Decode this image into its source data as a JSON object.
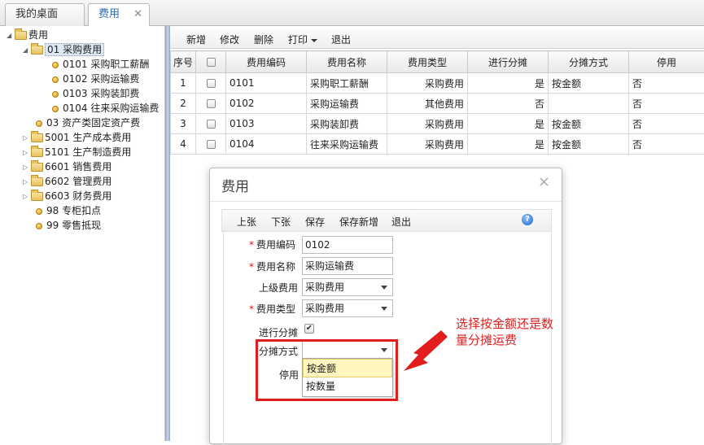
{
  "tabs": {
    "home": "我的桌面",
    "active": "费用",
    "close_glyph": "✕"
  },
  "tree": {
    "root": "费用",
    "nodes": [
      {
        "label": "01 采购费用",
        "level": 1,
        "kind": "folder-open"
      },
      {
        "label": "0101 采购职工薪酬",
        "level": 2,
        "kind": "leaf"
      },
      {
        "label": "0102 采购运输费",
        "level": 2,
        "kind": "leaf"
      },
      {
        "label": "0103 采购装卸费",
        "level": 2,
        "kind": "leaf"
      },
      {
        "label": "0104 往来采购运输费",
        "level": 2,
        "kind": "leaf"
      },
      {
        "label": "03 资产类固定资产费",
        "level": 1,
        "kind": "leaf"
      },
      {
        "label": "5001 生产成本费用",
        "level": 1,
        "kind": "folder"
      },
      {
        "label": "5101 生产制造费用",
        "level": 1,
        "kind": "folder"
      },
      {
        "label": "6601 销售费用",
        "level": 1,
        "kind": "folder"
      },
      {
        "label": "6602 管理费用",
        "level": 1,
        "kind": "folder"
      },
      {
        "label": "6603 财务费用",
        "level": 1,
        "kind": "folder"
      },
      {
        "label": "98 专柜扣点",
        "level": 1,
        "kind": "leaf"
      },
      {
        "label": "99 零售抵现",
        "level": 1,
        "kind": "leaf"
      }
    ]
  },
  "toolbar": {
    "add": "新增",
    "edit": "修改",
    "delete": "删除",
    "print": "打印",
    "exit": "退出"
  },
  "grid": {
    "headers": [
      "序号",
      "",
      "费用编码",
      "费用名称",
      "费用类型",
      "进行分摊",
      "分摊方式",
      "停用"
    ],
    "rows": [
      [
        "1",
        "",
        "0101",
        "采购职工薪酬",
        "采购费用",
        "是",
        "按金额",
        "否"
      ],
      [
        "2",
        "",
        "0102",
        "采购运输费",
        "其他费用",
        "否",
        "",
        "否"
      ],
      [
        "3",
        "",
        "0103",
        "采购装卸费",
        "采购费用",
        "是",
        "按金额",
        "否"
      ],
      [
        "4",
        "",
        "0104",
        "往来采购运输费",
        "采购费用",
        "是",
        "按金额",
        "否"
      ]
    ]
  },
  "dialog": {
    "title": "费用",
    "close_glyph": "×",
    "toolbar": {
      "prev": "上张",
      "next": "下张",
      "save": "保存",
      "save_new": "保存新增",
      "exit": "退出",
      "help": "?"
    },
    "form": {
      "code_label": "费用编码",
      "code_value": "0102",
      "name_label": "费用名称",
      "name_value": "采购运输费",
      "parent_label": "上级费用",
      "parent_value": "采购费用",
      "type_label": "费用类型",
      "type_value": "采购费用",
      "allocate_label": "进行分摊",
      "allocate_checked": true,
      "method_label": "分摊方式",
      "method_value": "",
      "disabled_label": "停用",
      "required_mark": "*",
      "method_options": [
        "按金额",
        "按数量"
      ]
    }
  },
  "annotation": {
    "text": "选择按金额还是数量分摊运费",
    "color": "#e21d1d"
  }
}
